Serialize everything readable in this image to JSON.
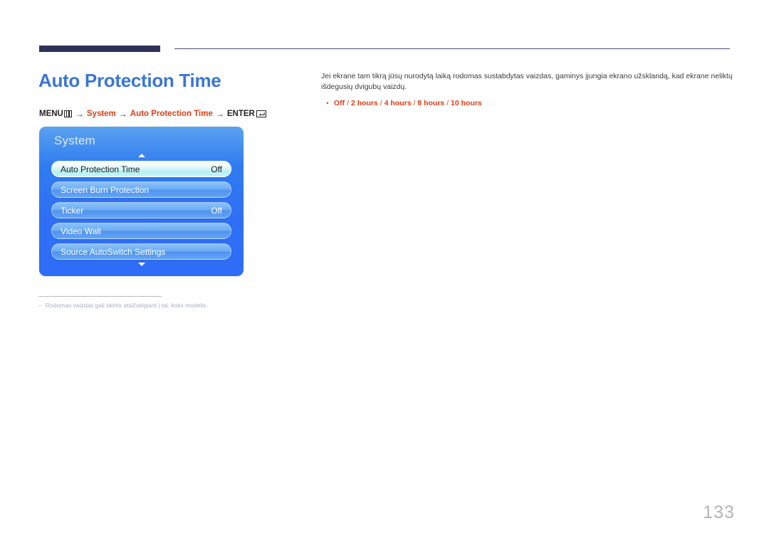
{
  "header": {
    "rule_color_thick": "#2e3158",
    "rule_color_thin": "#4a4f72"
  },
  "page": {
    "title": "Auto Protection Time",
    "title_color": "#3a75d6",
    "number": "133"
  },
  "menu_path": {
    "menu_label": "MENU",
    "menu_icon": "menu-bars-icon",
    "arrow": "→",
    "system_label": "System",
    "item_label": "Auto Protection Time",
    "enter_label": "ENTER",
    "enter_icon": "enter-key-icon",
    "highlight_color": "#e03c14"
  },
  "osd": {
    "title": "System",
    "scroll_up_icon": "chevron-up-icon",
    "scroll_down_icon": "chevron-down-icon",
    "rows": [
      {
        "label": "Auto Protection Time",
        "value": "Off",
        "selected": true
      },
      {
        "label": "Screen Burn Protection",
        "value": "",
        "selected": false
      },
      {
        "label": "Ticker",
        "value": "Off",
        "selected": false
      },
      {
        "label": "Video Wall",
        "value": "",
        "selected": false
      },
      {
        "label": "Source AutoSwitch Settings",
        "value": "",
        "selected": false
      }
    ]
  },
  "footnote": {
    "dash": "–",
    "text": "Rodomas vaizdas gali skirtis atsižvelgiant į tai, koks modelis."
  },
  "body": {
    "paragraph": "Jei ekrane tam tikrą jūsų nurodytą laiką rodomas sustabdytas vaizdas, gaminys įjungia ekrano užsklandą, kad ekrane neliktų išdegusių dvigubų vaizdų.",
    "bullet_marker": "•",
    "options": [
      "Off",
      "2 hours",
      "4 hours",
      "8 hours",
      "10 hours"
    ],
    "options_separator": " / "
  }
}
